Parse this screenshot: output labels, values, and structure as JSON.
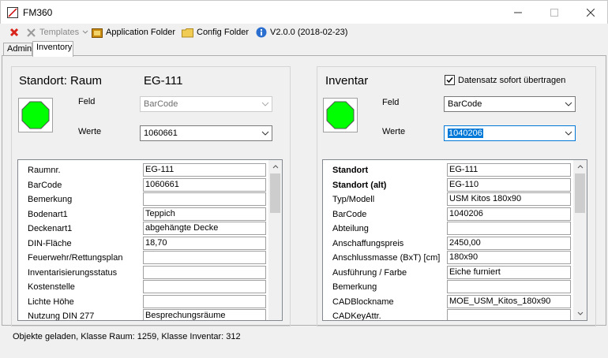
{
  "window": {
    "title": "FM360"
  },
  "toolbar": {
    "templates_label": "Templates",
    "app_folder_label": "Application Folder",
    "config_folder_label": "Config Folder",
    "version_label": "V2.0.0 (2018-02-23)"
  },
  "tabs": [
    {
      "label": "Admin"
    },
    {
      "label": "Inventory"
    }
  ],
  "left": {
    "title": "Standort: Raum",
    "room": "EG-111",
    "feld_label": "Feld",
    "feld_value": "BarCode",
    "werte_label": "Werte",
    "werte_value": "1060661",
    "status_color": "#00ff00",
    "rows": [
      {
        "label": "Raumnr.",
        "value": "EG-111"
      },
      {
        "label": "BarCode",
        "value": "1060661"
      },
      {
        "label": "Bemerkung",
        "value": ""
      },
      {
        "label": "Bodenart1",
        "value": "Teppich"
      },
      {
        "label": "Deckenart1",
        "value": "abgehängte Decke"
      },
      {
        "label": "DIN-Fläche",
        "value": "18,70"
      },
      {
        "label": "Feuerwehr/Rettungsplan",
        "value": ""
      },
      {
        "label": "Inventarisierungsstatus",
        "value": ""
      },
      {
        "label": "Kostenstelle",
        "value": ""
      },
      {
        "label": "Lichte Höhe",
        "value": ""
      },
      {
        "label": "Nutzung DIN 277",
        "value": "Besprechungsräume"
      }
    ]
  },
  "right": {
    "title": "Inventar",
    "checkbox_label": "Datensatz sofort übertragen",
    "checkbox_checked": true,
    "feld_label": "Feld",
    "feld_value": "BarCode",
    "werte_label": "Werte",
    "werte_value": "1040206",
    "status_color": "#00ff00",
    "rows": [
      {
        "label": "Standort",
        "value": "EG-111",
        "bold": true
      },
      {
        "label": "Standort (alt)",
        "value": "EG-110",
        "bold": true
      },
      {
        "label": "Typ/Modell",
        "value": "USM Kitos 180x90"
      },
      {
        "label": "BarCode",
        "value": "1040206"
      },
      {
        "label": "Abteilung",
        "value": ""
      },
      {
        "label": "Anschaffungspreis",
        "value": "2450,00"
      },
      {
        "label": "Anschlussmasse (BxT) [cm]",
        "value": "180x90"
      },
      {
        "label": "Ausführung / Farbe",
        "value": "Eiche furniert"
      },
      {
        "label": "Bemerkung",
        "value": ""
      },
      {
        "label": "CADBlockname",
        "value": "MOE_USM_Kitos_180x90"
      },
      {
        "label": "CADKeyAttr.",
        "value": ""
      }
    ]
  },
  "status": {
    "text": "Objekte geladen, Klasse Raum: 1259, Klasse Inventar: 312"
  }
}
